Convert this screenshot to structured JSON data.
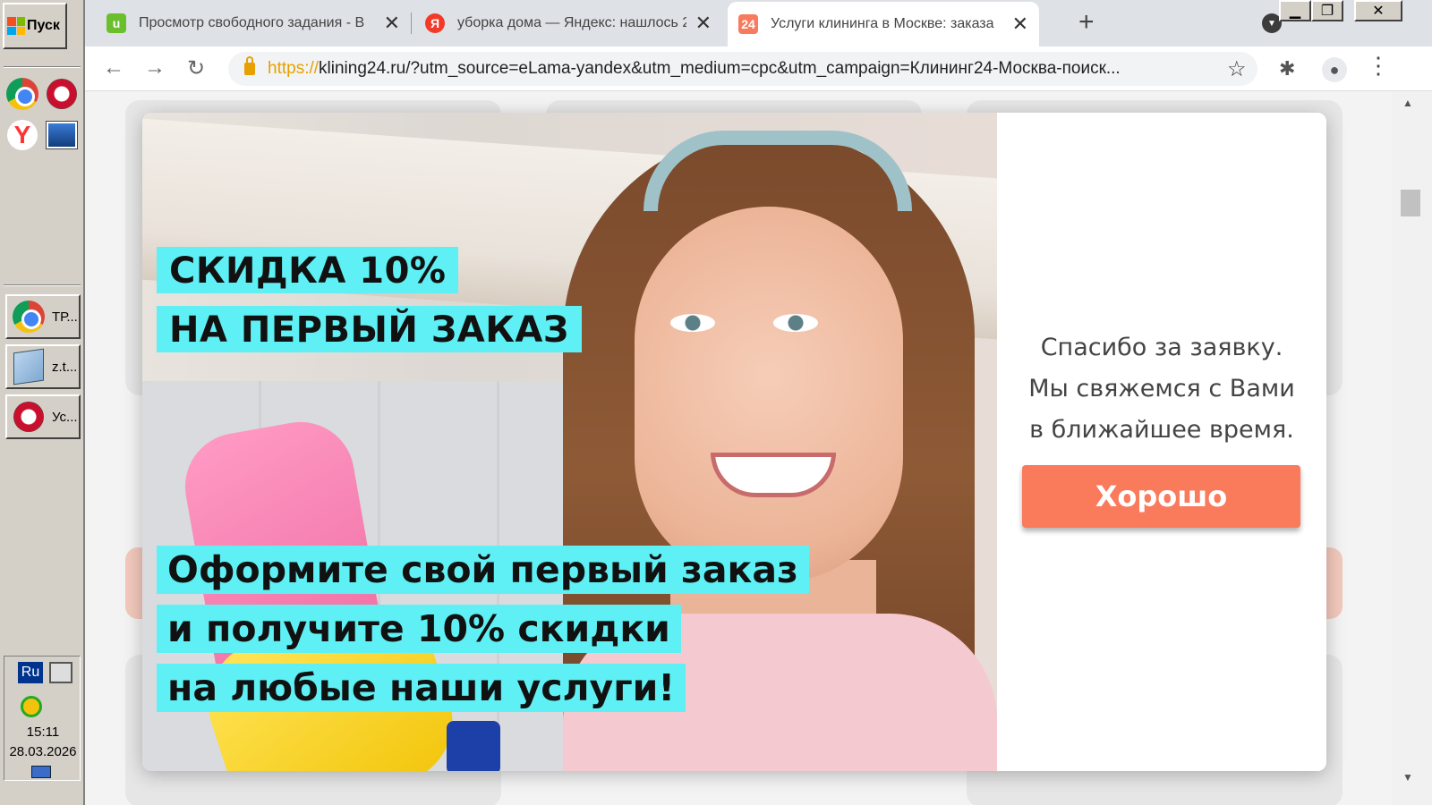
{
  "taskbar": {
    "start_label": "Пуск",
    "tasks": [
      {
        "label": "ТР...",
        "icon": "chrome-icon"
      },
      {
        "label": "z.t...",
        "icon": "notepad-icon"
      },
      {
        "label": "Ус...",
        "icon": "opera-icon"
      }
    ],
    "tray": {
      "lang": "Ru",
      "time": "15:11",
      "date": "28.03.2026"
    }
  },
  "browser": {
    "tabs": [
      {
        "title": "Просмотр свободного задания - В",
        "favicon_text": "u",
        "favicon_color": "#6cbf2c",
        "active": false
      },
      {
        "title": "уборка дома — Яндекс: нашлось 2",
        "favicon_text": "Я",
        "favicon_color": "#f33a2a",
        "active": false
      },
      {
        "title": "Услуги клининга в Москве: заказа",
        "favicon_text": "24",
        "favicon_color": "#f77b5c",
        "active": true
      }
    ],
    "new_tab_label": "+",
    "url_scheme": "https://",
    "url_rest": "klining24.ru/?utm_source=eLama-yandex&utm_medium=cpc&utm_campaign=Клининг24-Москва-поиск..."
  },
  "modal": {
    "promo_top": [
      "СКИДКА 10%",
      "НА ПЕРВЫЙ ЗАКАЗ"
    ],
    "promo_bottom": [
      "Оформите свой первый заказ",
      "и получите 10% скидки",
      "на любые наши услуги!"
    ],
    "message": [
      "Спасибо за заявку.",
      "Мы свяжемся с Вами",
      "в ближайшее время."
    ],
    "ok_label": "Хорошо",
    "accent_color": "#fa7a5c",
    "highlight_color": "#5ef0f4"
  }
}
